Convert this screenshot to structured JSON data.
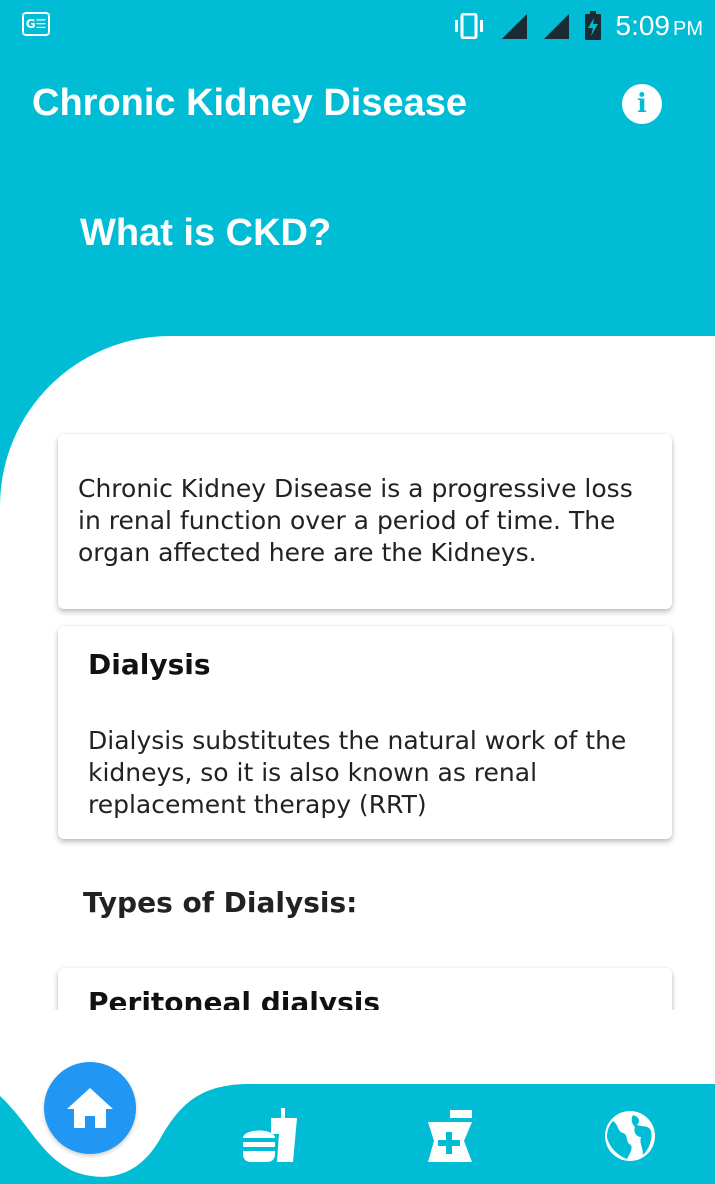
{
  "status_bar": {
    "time": "5:09",
    "ampm": "PM",
    "left_icon_label": "G☰"
  },
  "app_bar": {
    "title": "Chronic Kidney Disease",
    "info_label": "i"
  },
  "section": {
    "title": "What is CKD?"
  },
  "cards": [
    {
      "text": "Chronic Kidney Disease is a progressive loss in renal function over a period of time. The organ affected here are the Kidneys."
    },
    {
      "heading": "Dialysis",
      "text": "Dialysis substitutes the natural work of the kidneys, so it is also known as renal replacement therapy (RRT)"
    },
    {
      "heading": "Peritoneal dialysis"
    }
  ],
  "types_heading": "Types of Dialysis:",
  "bottom_nav": {
    "items": [
      {
        "icon": "home-icon",
        "active": true
      },
      {
        "icon": "fastfood-icon",
        "active": false
      },
      {
        "icon": "medication-icon",
        "active": false
      },
      {
        "icon": "globe-icon",
        "active": false
      }
    ]
  },
  "colors": {
    "primary": "#00BCD4",
    "accent": "#2196F3",
    "surface": "#FFFFFF",
    "text": "#222222"
  }
}
